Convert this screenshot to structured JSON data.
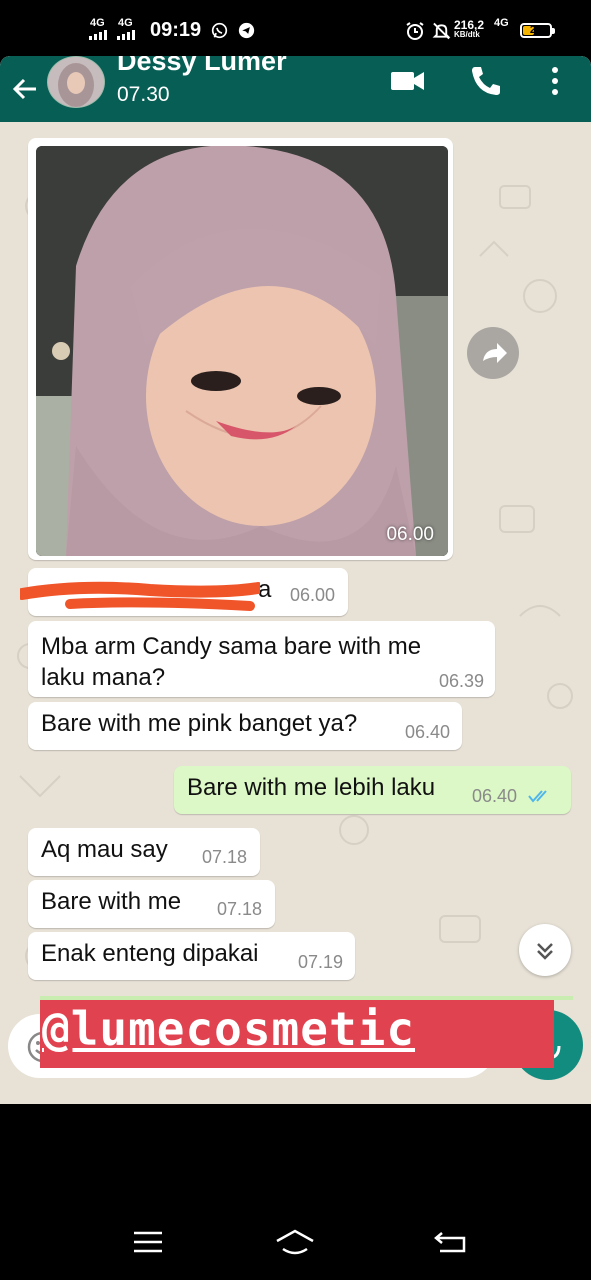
{
  "status_bar": {
    "network1": "4G",
    "network2": "4G",
    "time": "09:19",
    "speed_value": "216,2",
    "speed_unit": "KB/dtk",
    "network3": "4G",
    "battery": "27"
  },
  "chat": {
    "contact_name": "Dessy Lumer",
    "last_seen": "07.30"
  },
  "messages": [
    {
      "type": "image",
      "time": "06.00"
    },
    {
      "type": "text",
      "text": "a",
      "time": "06.00",
      "obscured": true
    },
    {
      "type": "text",
      "text": "Mba arm Candy sama bare with me",
      "text2": "laku mana?",
      "time": "06.39"
    },
    {
      "type": "text",
      "text": "Bare with me pink banget ya?",
      "time": "06.40"
    },
    {
      "type": "text",
      "text": "Bare with me lebih laku",
      "time": "06.40",
      "outgoing": true,
      "status": "read"
    },
    {
      "type": "text",
      "text": "Aq mau say",
      "time": "07.18"
    },
    {
      "type": "text",
      "text": "Bare with me",
      "time": "07.18"
    },
    {
      "type": "text",
      "text": "Enak enteng dipakai",
      "time": "07.19"
    }
  ],
  "watermark": "@lumecosmetic",
  "icons": [
    "signal-icon",
    "whatsapp-icon",
    "telegram-icon",
    "alarm-icon",
    "mute-icon",
    "battery-icon",
    "back-arrow-icon",
    "video-call-icon",
    "phone-icon",
    "more-vert-icon",
    "forward-icon",
    "chevron-double-down-icon",
    "emoji-icon",
    "mic-icon",
    "menu-icon",
    "home-icon",
    "back-icon"
  ],
  "colors": {
    "header": "#075e54",
    "outgoing": "#dcf8c6",
    "incoming": "#ffffff",
    "watermark": "#e0424f",
    "read_ticks": "#4fb6ec"
  }
}
